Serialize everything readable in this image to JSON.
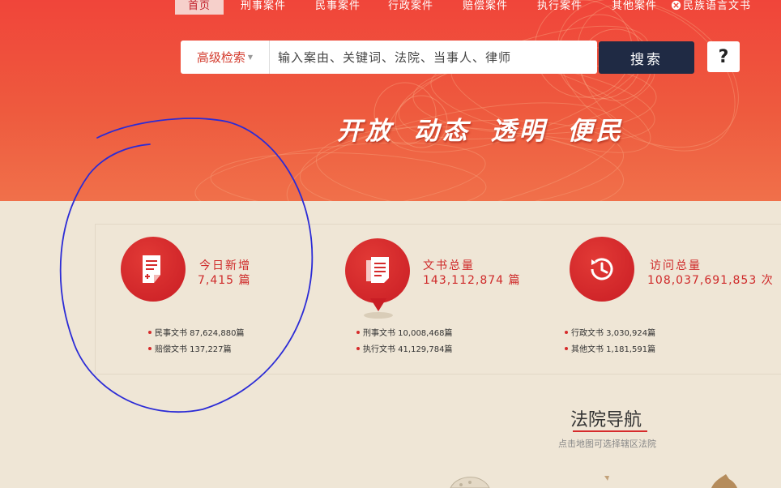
{
  "nav": {
    "items": [
      {
        "label": "首页"
      },
      {
        "label": "刑事案件"
      },
      {
        "label": "民事案件"
      },
      {
        "label": "行政案件"
      },
      {
        "label": "赔偿案件"
      },
      {
        "label": "执行案件"
      },
      {
        "label": "其他案件"
      },
      {
        "label": "民族语言文书"
      }
    ]
  },
  "search": {
    "advanced_label": "高级检索",
    "placeholder": "输入案由、关键词、法院、当事人、律师",
    "button_label": "搜索",
    "help_label": "?"
  },
  "banner": {
    "slogan": "开放 动态 透明 便民"
  },
  "stats": [
    {
      "title": "今日新增",
      "value": "7,415 篇",
      "icon": "new-document-icon",
      "sub": [
        "民事文书 87,624,880篇",
        "赔偿文书 137,227篇"
      ]
    },
    {
      "title": "文书总量",
      "value": "143,112,874 篇",
      "icon": "documents-pin-icon",
      "sub": [
        "刑事文书 10,008,468篇",
        "执行文书 41,129,784篇"
      ]
    },
    {
      "title": "访问总量",
      "value": "108,037,691,853 次",
      "icon": "clock-history-icon",
      "sub": [
        "行政文书 3,030,924篇",
        "其他文书 1,181,591篇"
      ]
    }
  ],
  "court_nav": {
    "title": "法院导航",
    "subtitle": "点击地图可选择辖区法院"
  },
  "colors": {
    "banner_red": "#ee4b3c",
    "accent_red": "#cf2a2a",
    "search_button": "#1f2a44",
    "page_background": "#efe6d6",
    "annotation_stroke": "#2b2bd6"
  }
}
